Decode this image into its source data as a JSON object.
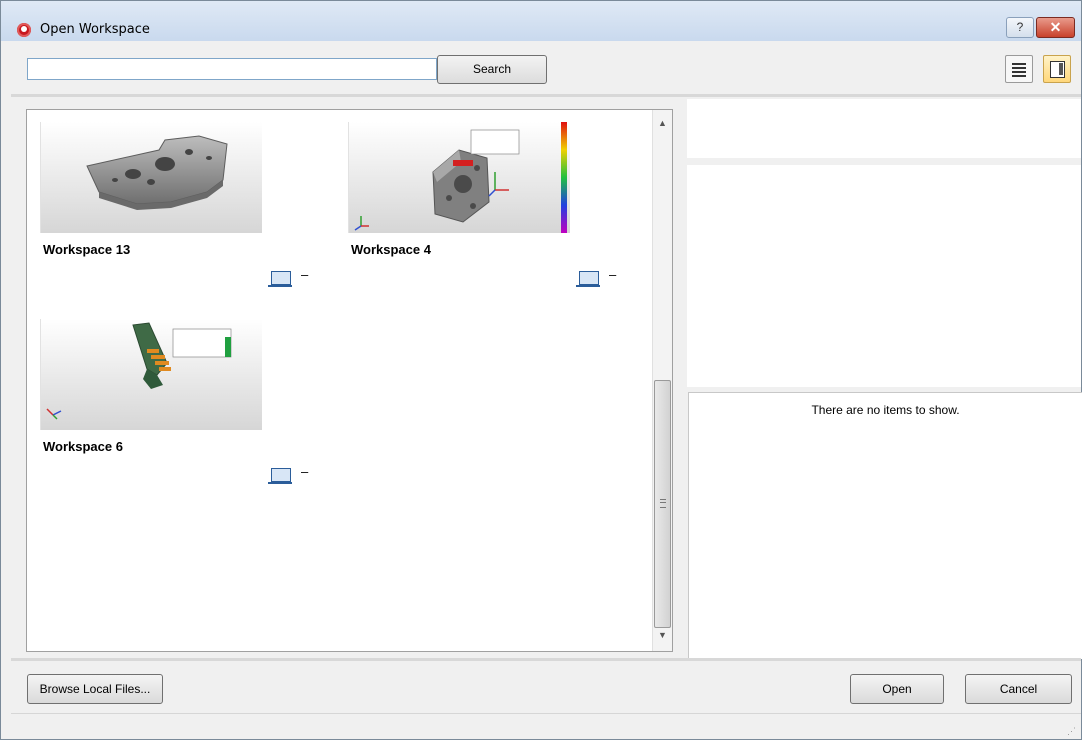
{
  "window": {
    "title": "Open Workspace",
    "help_button": "?",
    "close_button": "✕"
  },
  "search": {
    "value": "",
    "placeholder": "",
    "button_label": "Search"
  },
  "workspaces": [
    {
      "name": "Workspace 13",
      "status": "–"
    },
    {
      "name": "Workspace 4",
      "status": "–"
    },
    {
      "name": "Workspace 6",
      "status": "–"
    }
  ],
  "details": {
    "empty_message": "There are no items to show."
  },
  "footer": {
    "browse_label": "Browse Local Files...",
    "open_label": "Open",
    "cancel_label": "Cancel"
  }
}
